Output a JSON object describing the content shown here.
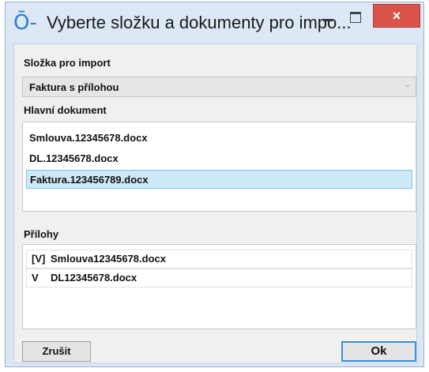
{
  "window": {
    "title": "Vyberte složku a dokumenty pro impo...",
    "app_icon": "Ō-",
    "close_glyph": "×"
  },
  "folder": {
    "label": "Složka pro import",
    "selected": "Faktura s přílohou"
  },
  "main_document": {
    "label": "Hlavní dokument",
    "items": [
      {
        "name": "Smlouva.12345678.docx",
        "selected": false
      },
      {
        "name": "DL.12345678.docx",
        "selected": false
      },
      {
        "name": "Faktura.123456789.docx",
        "selected": true
      }
    ]
  },
  "attachments": {
    "label": "Přílohy",
    "items": [
      {
        "check": "[V]",
        "name": "Smlouva12345678.docx"
      },
      {
        "check": "V",
        "name": "DL12345678.docx"
      }
    ]
  },
  "buttons": {
    "cancel": "Zrušit",
    "ok": "Ok"
  },
  "colors": {
    "accent": "#3c8fd8",
    "selection": "#cde8f7",
    "close": "#d8544a"
  }
}
